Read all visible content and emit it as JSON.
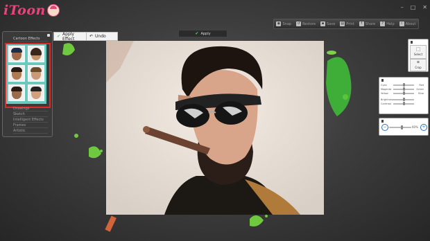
{
  "app": {
    "logo_text": "iToon"
  },
  "toolbar": {
    "items": [
      {
        "icon": "camera-icon",
        "label": "Snap"
      },
      {
        "icon": "restore-icon",
        "label": "Restore"
      },
      {
        "icon": "save-icon",
        "label": "Save"
      },
      {
        "icon": "print-icon",
        "label": "Print"
      },
      {
        "icon": "facebook-icon",
        "label": "Share"
      },
      {
        "icon": "help-icon",
        "label": "Help"
      },
      {
        "icon": "about-icon",
        "label": "About"
      }
    ]
  },
  "apply_label": "Apply",
  "apply_effect_label": "Apply Effect",
  "undo_label": "Undo",
  "left_panel": {
    "categories": [
      "Cartoon Effects",
      "Drawings",
      "Sketch",
      "Intelligent Effects",
      "Frames",
      "Artistic"
    ]
  },
  "right_panel": {
    "select_label": "Select",
    "crop_label": "Crop",
    "color_sliders": [
      {
        "left": "Cyan",
        "right": "Red",
        "value": 0.5
      },
      {
        "left": "Magenta",
        "right": "Green",
        "value": 0.5
      },
      {
        "left": "Yellow",
        "right": "Blue",
        "value": 0.5
      },
      {
        "left": "Brightness",
        "right": "",
        "value": 0.5
      },
      {
        "left": "Contrast",
        "right": "",
        "value": 0.5
      }
    ],
    "zoom_value": "60%",
    "zoom_level": 0.6
  }
}
